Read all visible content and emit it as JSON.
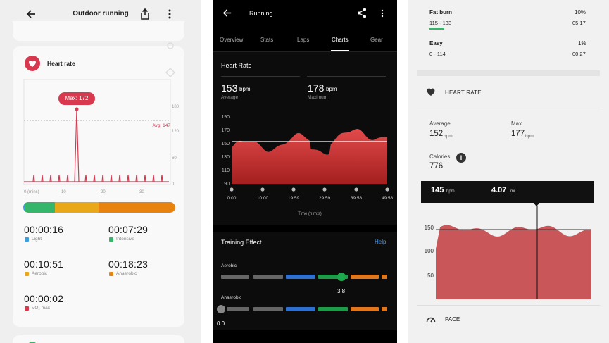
{
  "panel1": {
    "title": "Outdoor running",
    "card_title": "Heart rate",
    "max_label": "Max: 172",
    "avg_label": "Avg: 147",
    "y_ticks": [
      "180",
      "120",
      "60",
      "0"
    ],
    "x_ticks": [
      "0 (mins)",
      "10",
      "20",
      "30"
    ],
    "zone_colors": [
      "#3aa0df",
      "#35b66a",
      "#e8a818",
      "#e8830f"
    ],
    "zones": [
      {
        "time": "00:00:16",
        "label": "Light"
      },
      {
        "time": "00:07:29",
        "label": "Intensive"
      },
      {
        "time": "00:10:51",
        "label": "Aerobic"
      },
      {
        "time": "00:18:23",
        "label": "Anaerobic"
      },
      {
        "time": "00:00:02",
        "label": "VO₂ max"
      }
    ],
    "accent": "#d8394f"
  },
  "panel2": {
    "title": "Running",
    "tabs": [
      "Overview",
      "Stats",
      "Laps",
      "Charts",
      "Gear"
    ],
    "active_tab": "Charts",
    "section_title": "Heart Rate",
    "avg_value": "153",
    "avg_unit": "bpm",
    "avg_label": "Average",
    "max_value": "178",
    "max_unit": "bpm",
    "max_label": "Maximum",
    "y_ticks": [
      "190",
      "170",
      "150",
      "130",
      "110",
      "90"
    ],
    "x_ticks": [
      "0:00",
      "10:00",
      "19:59",
      "29:59",
      "39:58",
      "49:58"
    ],
    "x_axis_label": "Time (h:m:s)",
    "training_title": "Training Effect",
    "help_label": "Help",
    "aerobic_label": "Aerobic",
    "aerobic_value": "3.8",
    "anaerobic_label": "Anaerobic",
    "anaerobic_value": "0.0"
  },
  "panel3": {
    "zones": [
      {
        "name": "Fat burn",
        "range": "115 - 133",
        "percent": "10%",
        "time": "05:17"
      },
      {
        "name": "Easy",
        "range": "0 - 114",
        "percent": "1%",
        "time": "00:27"
      }
    ],
    "section_title": "HEART RATE",
    "average_label": "Average",
    "average_value": "152",
    "average_unit": "bpm",
    "max_label": "Max",
    "max_value": "177",
    "max_unit": "bpm",
    "calories_label": "Calories",
    "calories_value": "776",
    "tooltip_hr": "145",
    "tooltip_hr_unit": "bpm",
    "tooltip_dist": "4.07",
    "tooltip_dist_unit": "mi",
    "y_ticks": [
      "150",
      "100",
      "50"
    ],
    "next_section": "PACE"
  }
}
